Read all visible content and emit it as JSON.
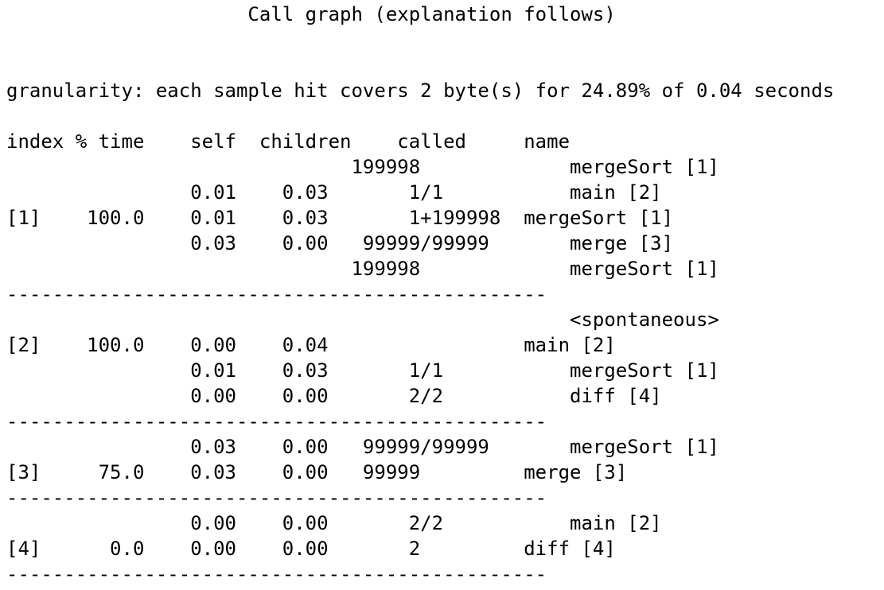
{
  "terminal": {
    "lines": [
      "                     Call graph (explanation follows)",
      "",
      "",
      "granularity: each sample hit covers 2 byte(s) for 24.89% of 0.04 seconds",
      "",
      "index % time    self  children    called     name",
      "                              199998             mergeSort [1]",
      "                0.01    0.03       1/1           main [2]",
      "[1]    100.0    0.01    0.03       1+199998  mergeSort [1]",
      "                0.03    0.00   99999/99999       merge [3]",
      "                              199998             mergeSort [1]",
      "-----------------------------------------------",
      "                                                 <spontaneous>",
      "[2]    100.0    0.00    0.04                 main [2]",
      "                0.01    0.03       1/1           mergeSort [1]",
      "                0.00    0.00       2/2           diff [4]",
      "-----------------------------------------------",
      "                0.03    0.00   99999/99999       mergeSort [1]",
      "[3]     75.0    0.03    0.00   99999         merge [3]",
      "-----------------------------------------------",
      "                0.00    0.00       2/2           main [2]",
      "[4]      0.0    0.00    0.00       2         diff [4]",
      "-----------------------------------------------"
    ]
  }
}
